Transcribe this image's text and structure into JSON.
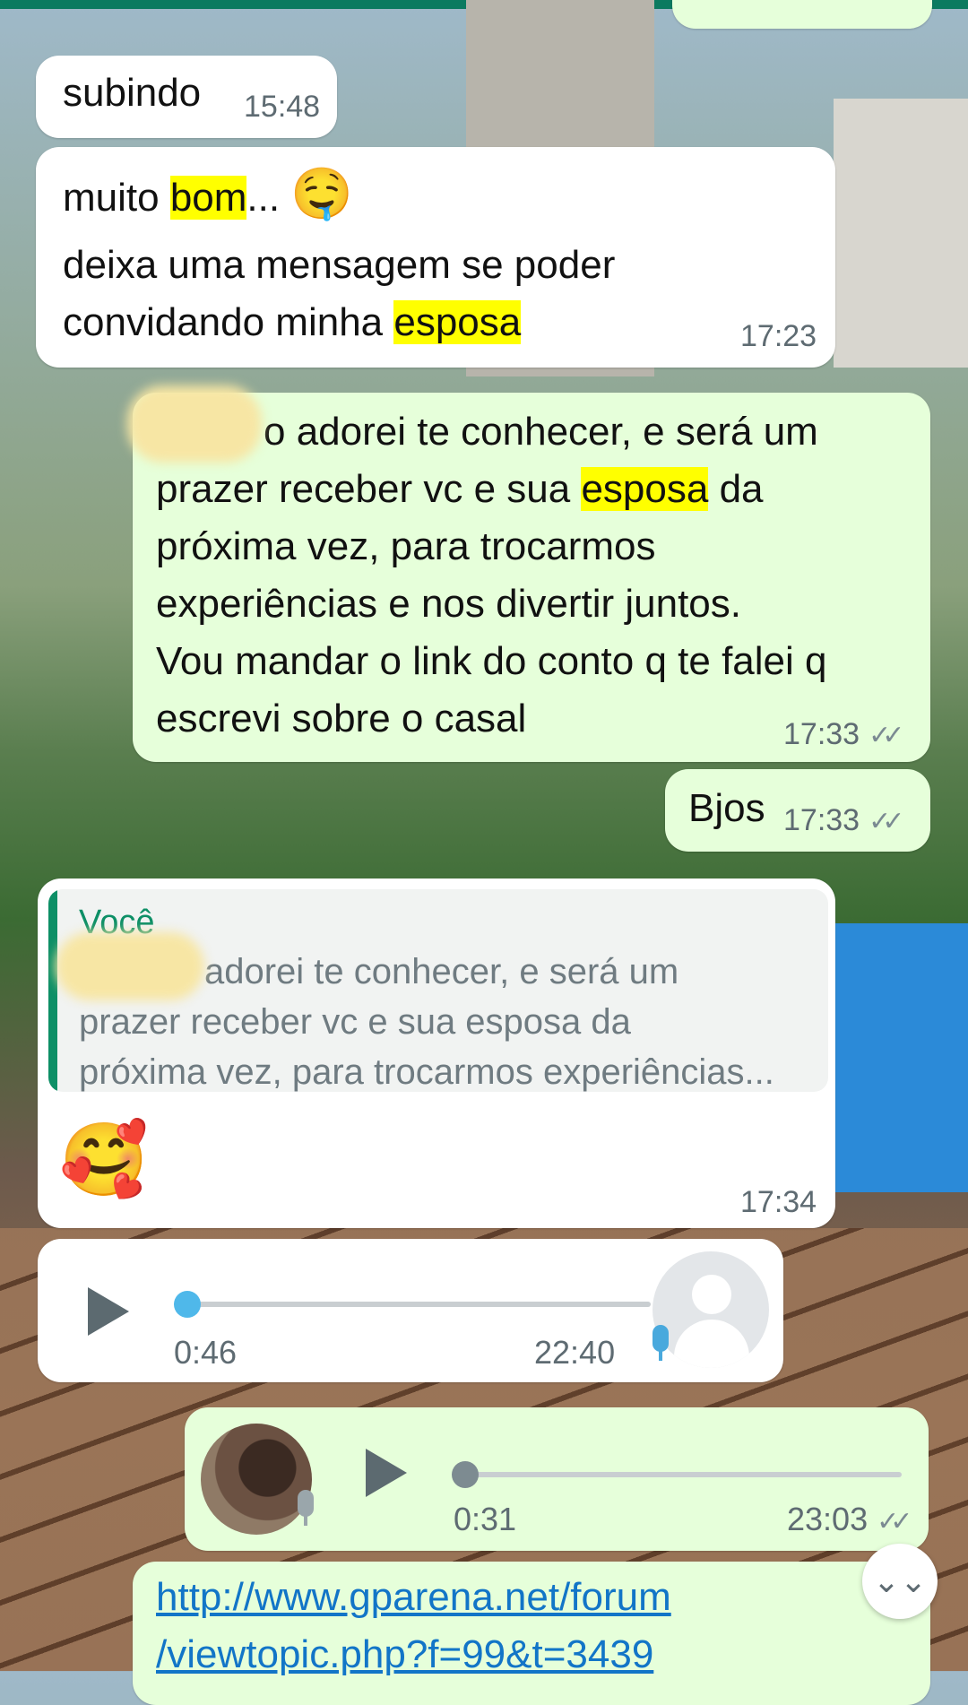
{
  "messages": {
    "m1": {
      "text": "subindo",
      "time": "15:48"
    },
    "m2": {
      "line1_a": "muito ",
      "line1_hl": "bom",
      "line1_b": "...",
      "emoji": "🤤",
      "line2": "deixa uma mensagem se poder",
      "line3_a": "convidando minha ",
      "line3_hl": "esposa",
      "time": "17:23"
    },
    "m3": {
      "line1": "o adorei te conhecer,  e será um",
      "line2_a": "prazer receber vc  e sua ",
      "line2_hl": "esposa",
      "line2_b": " da",
      "line3": "próxima vez, para trocarmos",
      "line4": "experiências e nos divertir juntos.",
      "line5": "Vou mandar o link do conto q te falei q",
      "line6": "escrevi sobre o casal",
      "time": "17:33"
    },
    "m4": {
      "text": "Bjos",
      "time": "17:33"
    },
    "m5": {
      "quote_author": "Você",
      "quote_line1": "adorei te conhecer,  e será um",
      "quote_line2": "prazer receber vc  e sua esposa da",
      "quote_line3": "próxima vez, para trocarmos experiências...",
      "emoji": "🥰",
      "time": "17:34"
    },
    "audio_in": {
      "duration": "0:46",
      "time": "22:40",
      "progress": 0
    },
    "audio_out": {
      "duration": "0:31",
      "time": "23:03",
      "progress": 0
    },
    "link_msg": {
      "line1": "http://www.gparena.net/forum",
      "line2": "/viewtopic.php?f=99&t=3439"
    }
  },
  "icons": {
    "read_ticks": "✓✓",
    "scroll_down": "⌄⌄"
  },
  "colors": {
    "incoming_bubble": "#ffffff",
    "outgoing_bubble": "#e6ffda",
    "highlight": "#ffff00",
    "accent_green": "#0d8f66",
    "link": "#1275c7",
    "audio_dot_in": "#4fb8ea"
  }
}
